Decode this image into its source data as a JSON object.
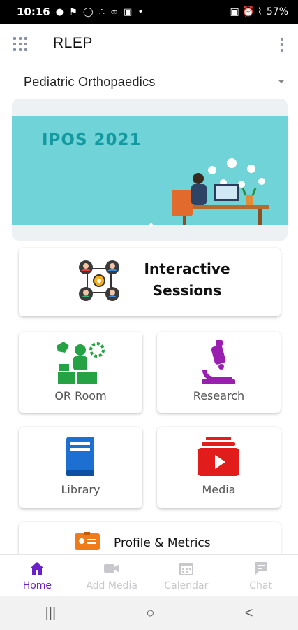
{
  "status_bar": {
    "time": "10:16",
    "notifications": "● ⚑ ◯ ∴ ∞ ▣ •",
    "right_icons": "▣ ⏰ ⌇",
    "battery": "57%"
  },
  "app_bar": {
    "title": "RLEP"
  },
  "specialty_dropdown": {
    "selected": "Pediatric Orthopaedics"
  },
  "banner": {
    "title": "IPOS 2021"
  },
  "cards": {
    "interactive": {
      "line1": "Interactive",
      "line2": "Sessions"
    },
    "or_room": "OR Room",
    "research": "Research",
    "library": "Library",
    "media": "Media",
    "profile": "Profile & Metrics"
  },
  "bottom_nav": [
    {
      "label": "Home",
      "icon": "home-icon",
      "active": true
    },
    {
      "label": "Add Media",
      "icon": "video-camera-icon",
      "active": false
    },
    {
      "label": "Calendar",
      "icon": "calendar-icon",
      "active": false
    },
    {
      "label": "Chat",
      "icon": "chat-bubble-icon",
      "active": false
    }
  ],
  "system_nav": {
    "recents": "|||",
    "home": "○",
    "back": "<"
  },
  "colors": {
    "accent": "#6a1fc9",
    "banner_bg": "#6fd3d7",
    "banner_title": "#139aa0",
    "or_room_icon": "#25a244",
    "research_icon": "#9a1fb0",
    "library_icon": "#1d6fd1",
    "media_icon": "#e21b1b",
    "profile_icon": "#ef7b1a"
  }
}
